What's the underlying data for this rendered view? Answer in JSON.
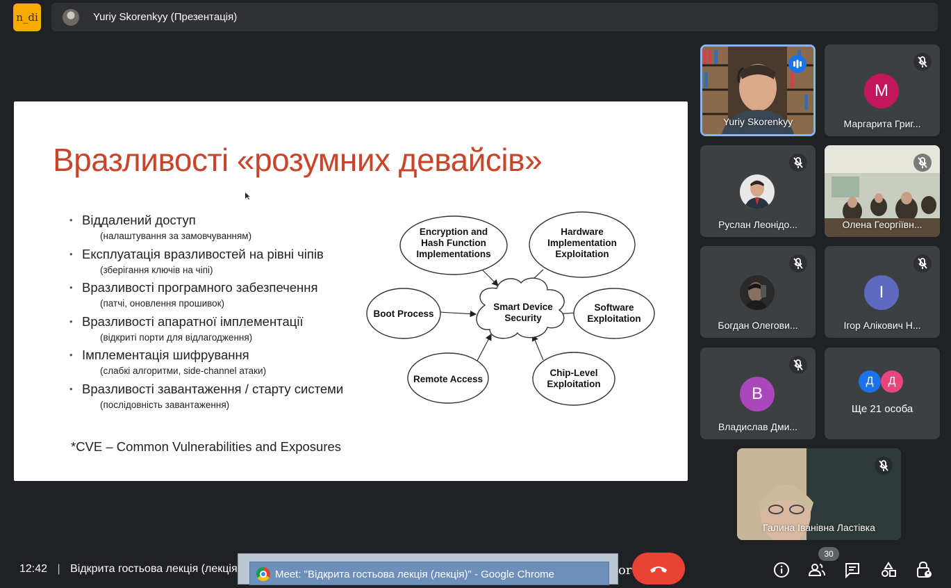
{
  "app_badge": "n_di",
  "presenter": {
    "name": "Yuriy Skorenkyy (Презентація)"
  },
  "slide": {
    "title": "Вразливості «розумних девайсів»",
    "bullets": [
      {
        "main": "Віддалений доступ",
        "sub": "(налаштування за замовчуванням)"
      },
      {
        "main": "Експлуатація вразливостей на рівні чіпів",
        "sub": "(зберігання ключів на чіпі)"
      },
      {
        "main": "Вразливості програмного забезпечення",
        "sub": "(патчі, оновлення прошивок)"
      },
      {
        "main": "Вразливості апаратної імплементації",
        "sub": "(відкриті порти для відлагодження)"
      },
      {
        "main": "Імплементація шифрування",
        "sub": "(слабкі алгоритми, side-channel атаки)"
      },
      {
        "main": "Вразливості завантаження / старту системи",
        "sub": "(послідовність завантаження)"
      }
    ],
    "bullet_glyph": "•",
    "footnote": "*CVE – Common Vulnerabilities and Exposures",
    "diagram": {
      "center": [
        "Smart Device",
        "Security"
      ],
      "nodes": {
        "encryption": [
          "Encryption and",
          "Hash Function",
          "Implementations"
        ],
        "hardware": [
          "Hardware",
          "Implementation",
          "Exploitation"
        ],
        "boot": [
          "Boot Process"
        ],
        "software": [
          "Software",
          "Exploitation"
        ],
        "remote": [
          "Remote Access"
        ],
        "chip": [
          "Chip-Level",
          "Exploitation"
        ]
      }
    }
  },
  "participants": [
    {
      "name": "Yuriy Skorenkyy",
      "type": "video",
      "speaking": true
    },
    {
      "name": "Маргарита Григ...",
      "initial": "M",
      "color": "#c2185b"
    },
    {
      "name": "Руслан Леонідо...",
      "type": "photo"
    },
    {
      "name": "Олена Георгіївн...",
      "type": "video"
    },
    {
      "name": "Богдан Олегови...",
      "type": "photo"
    },
    {
      "name": "Ігор Алікович Н...",
      "initial": "I",
      "color": "#5c6bc0"
    },
    {
      "name": "Владислав Дми...",
      "initial": "B",
      "color": "#ab47bc"
    },
    {
      "name": "Ще 21 особа",
      "initials": [
        "Д",
        "Д"
      ],
      "colors": [
        "#1a73e8",
        "#e8457a"
      ]
    },
    {
      "name": "Галина Іванівна Ластівка",
      "type": "video"
    }
  ],
  "bottom": {
    "time": "12:42",
    "separator": "|",
    "meeting_title": "Відкрита гостьова лекція (лекція)",
    "taskbar_tooltip": "Meet: \"Відкрита гостьова лекція (лекція)\" - Google Chrome",
    "tail_char": "or",
    "participant_count": "30"
  },
  "colors": {
    "background": "#202124",
    "tile": "#3c4043",
    "accent": "#8ab4f8",
    "hangup": "#ea4335",
    "title_red": "#c9452a"
  }
}
